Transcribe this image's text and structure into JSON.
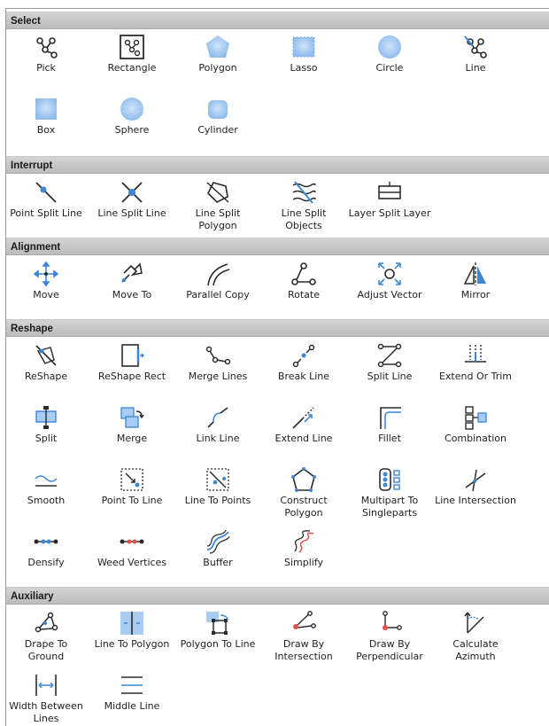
{
  "sections": {
    "select": {
      "title": "Select",
      "tools": [
        {
          "label": "Pick",
          "icon": "pick-icon"
        },
        {
          "label": "Rectangle",
          "icon": "rectangle-select-icon"
        },
        {
          "label": "Polygon",
          "icon": "polygon-select-icon"
        },
        {
          "label": "Lasso",
          "icon": "lasso-select-icon"
        },
        {
          "label": "Circle",
          "icon": "circle-select-icon"
        },
        {
          "label": "Line",
          "icon": "line-select-icon"
        },
        {
          "label": "Box",
          "icon": "box-select-icon"
        },
        {
          "label": "Sphere",
          "icon": "sphere-select-icon"
        },
        {
          "label": "Cylinder",
          "icon": "cylinder-select-icon"
        }
      ]
    },
    "interrupt": {
      "title": "Interrupt",
      "tools": [
        {
          "label": "Point Split Line",
          "icon": "point-split-line-icon"
        },
        {
          "label": "Line Split Line",
          "icon": "line-split-line-icon"
        },
        {
          "label1": "Line Split",
          "label2": "Polygon",
          "icon": "line-split-polygon-icon"
        },
        {
          "label1": "Line Split",
          "label2": "Objects",
          "icon": "line-split-objects-icon"
        },
        {
          "label": "Layer Split Layer",
          "icon": "layer-split-layer-icon"
        }
      ]
    },
    "alignment": {
      "title": "Alignment",
      "tools": [
        {
          "label": "Move",
          "icon": "move-icon"
        },
        {
          "label": "Move To",
          "icon": "move-to-icon"
        },
        {
          "label": "Parallel Copy",
          "icon": "parallel-copy-icon"
        },
        {
          "label": "Rotate",
          "icon": "rotate-icon"
        },
        {
          "label": "Adjust Vector",
          "icon": "adjust-vector-icon"
        },
        {
          "label": "Mirror",
          "icon": "mirror-icon"
        }
      ]
    },
    "reshape": {
      "title": "Reshape",
      "tools": [
        {
          "label": "ReShape",
          "icon": "reshape-icon"
        },
        {
          "label": "ReShape Rect",
          "icon": "reshape-rect-icon"
        },
        {
          "label": "Merge Lines",
          "icon": "merge-lines-icon"
        },
        {
          "label": "Break Line",
          "icon": "break-line-icon"
        },
        {
          "label": "Split Line",
          "icon": "split-line-icon"
        },
        {
          "label": "Extend Or Trim",
          "icon": "extend-or-trim-icon"
        },
        {
          "label": "Split",
          "icon": "split-icon"
        },
        {
          "label": "Merge",
          "icon": "merge-icon"
        },
        {
          "label": "Link Line",
          "icon": "link-line-icon"
        },
        {
          "label": "Extend Line",
          "icon": "extend-line-icon"
        },
        {
          "label": "Fillet",
          "icon": "fillet-icon"
        },
        {
          "label": "Combination",
          "icon": "combination-icon"
        },
        {
          "label": "Smooth",
          "icon": "smooth-icon"
        },
        {
          "label": "Point To Line",
          "icon": "point-to-line-icon"
        },
        {
          "label": "Line To Points",
          "icon": "line-to-points-icon"
        },
        {
          "label1": "Construct",
          "label2": "Polygon",
          "icon": "construct-polygon-icon"
        },
        {
          "label1": "Multipart To",
          "label2": "Singleparts",
          "icon": "multipart-to-singleparts-icon"
        },
        {
          "label": "Line Intersection",
          "icon": "line-intersection-icon"
        },
        {
          "label": "Densify",
          "icon": "densify-icon"
        },
        {
          "label": "Weed Vertices",
          "icon": "weed-vertices-icon"
        },
        {
          "label": "Buffer",
          "icon": "buffer-icon"
        },
        {
          "label": "Simplify",
          "icon": "simplify-icon"
        }
      ]
    },
    "auxiliary": {
      "title": "Auxiliary",
      "tools": [
        {
          "label1": "Drape To",
          "label2": "Ground",
          "icon": "drape-to-ground-icon"
        },
        {
          "label": "Line To Polygon",
          "icon": "line-to-polygon-icon"
        },
        {
          "label": "Polygon To Line",
          "icon": "polygon-to-line-icon"
        },
        {
          "label1": "Draw By",
          "label2": "Intersection",
          "icon": "draw-by-intersection-icon"
        },
        {
          "label1": "Draw By",
          "label2": "Perpendicular",
          "icon": "draw-by-perpendicular-icon"
        },
        {
          "label1": "Calculate",
          "label2": "Azimuth",
          "icon": "calculate-azimuth-icon"
        },
        {
          "label1": "Width Between",
          "label2": "Lines",
          "icon": "width-between-lines-icon"
        },
        {
          "label": "Middle Line",
          "icon": "middle-line-icon"
        }
      ]
    }
  },
  "colors": {
    "accent_blue": "#3b86d8",
    "light_blue": "#a9cdf2",
    "red": "#e0524a",
    "ink": "#2b2b2b"
  }
}
